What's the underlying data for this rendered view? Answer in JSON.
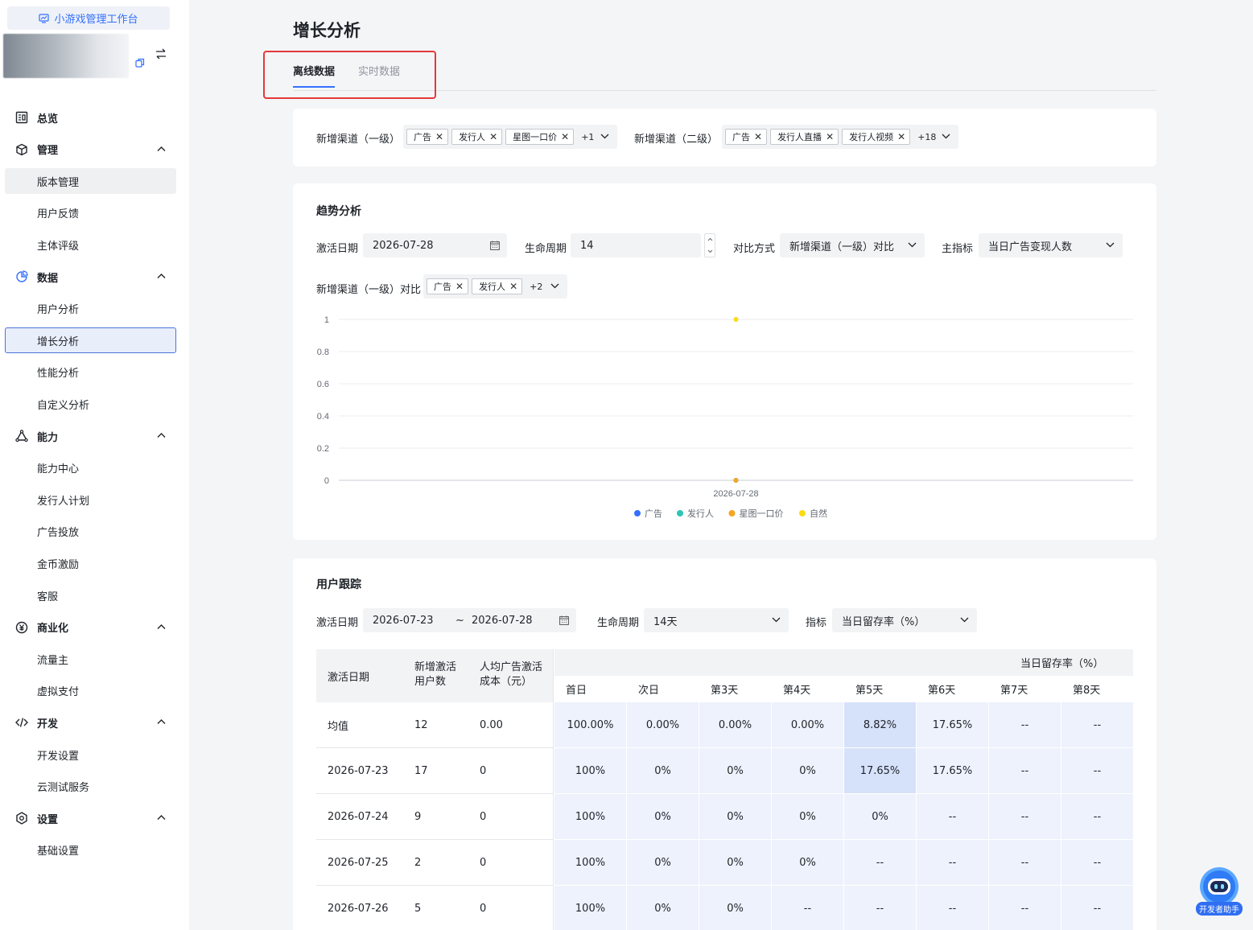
{
  "sidebar": {
    "workspace_label": "小游戏管理工作台",
    "groups": [
      {
        "label": "总览"
      },
      {
        "label": "管理",
        "items": [
          "版本管理",
          "用户反馈",
          "主体评级"
        ]
      },
      {
        "label": "数据",
        "items": [
          "用户分析",
          "增长分析",
          "性能分析",
          "自定义分析"
        ]
      },
      {
        "label": "能力",
        "items": [
          "能力中心",
          "发行人计划",
          "广告投放",
          "金币激励",
          "客服"
        ]
      },
      {
        "label": "商业化",
        "items": [
          "流量主",
          "虚拟支付"
        ]
      },
      {
        "label": "开发",
        "items": [
          "开发设置",
          "云测试服务"
        ]
      },
      {
        "label": "设置",
        "items": [
          "基础设置"
        ]
      }
    ]
  },
  "page": {
    "title": "增长分析",
    "tabs": [
      "离线数据",
      "实时数据"
    ]
  },
  "filters": {
    "ch1_label": "新增渠道（一级）",
    "ch1_tags": [
      "广告",
      "发行人",
      "星图一口价"
    ],
    "ch1_more": "+1",
    "ch2_label": "新增渠道（二级）",
    "ch2_tags": [
      "广告",
      "发行人直播",
      "发行人视频"
    ],
    "ch2_more": "+18"
  },
  "trend": {
    "title": "趋势分析",
    "date_label": "激活日期",
    "date_value": "2026-07-28",
    "life_label": "生命周期",
    "life_value": "14",
    "compare_label": "对比方式",
    "compare_value": "新增渠道（一级）对比",
    "metric_label": "主指标",
    "metric_value": "当日广告变现人数",
    "ch_label": "新增渠道（一级）对比",
    "ch_tags": [
      "广告",
      "发行人"
    ],
    "ch_more": "+2"
  },
  "chart_data": {
    "type": "line",
    "categories": [
      "2026-07-28"
    ],
    "y_ticks": [
      "1",
      "0.8",
      "0.6",
      "0.4",
      "0.2",
      "0"
    ],
    "ylim": [
      0,
      1
    ],
    "series": [
      {
        "name": "广告",
        "color": "#3370ff",
        "values": [
          0
        ]
      },
      {
        "name": "发行人",
        "color": "#2ec5b6",
        "values": [
          0
        ]
      },
      {
        "name": "星图一口价",
        "color": "#f5a623",
        "values": [
          0
        ]
      },
      {
        "name": "自然",
        "color": "#fadb14",
        "values": [
          1
        ]
      }
    ],
    "legend": "bottom",
    "grid": true
  },
  "tracking": {
    "title": "用户跟踪",
    "date_label": "激活日期",
    "date_start": "2026-07-23",
    "date_sep": "~",
    "date_end": "2026-07-28",
    "life_label": "生命周期",
    "life_value": "14天",
    "metric_label": "指标",
    "metric_value": "当日留存率（%）",
    "table": {
      "col_date": "激活日期",
      "col_users": "新增激活用户数",
      "col_cost": "人均广告激活成本（元）",
      "group_header": "当日留存率（%）",
      "day_headers": [
        "首日",
        "次日",
        "第3天",
        "第4天",
        "第5天",
        "第6天",
        "第7天",
        "第8天"
      ],
      "rows": [
        {
          "date": "均值",
          "users": "12",
          "cost": "0.00",
          "vals": [
            "100.00%",
            "0.00%",
            "0.00%",
            "0.00%",
            "8.82%",
            "17.65%",
            "--",
            "--"
          ]
        },
        {
          "date": "2026-07-23",
          "users": "17",
          "cost": "0",
          "vals": [
            "100%",
            "0%",
            "0%",
            "0%",
            "17.65%",
            "17.65%",
            "--",
            "--"
          ]
        },
        {
          "date": "2026-07-24",
          "users": "9",
          "cost": "0",
          "vals": [
            "100%",
            "0%",
            "0%",
            "0%",
            "0%",
            "--",
            "--",
            "--"
          ]
        },
        {
          "date": "2026-07-25",
          "users": "2",
          "cost": "0",
          "vals": [
            "100%",
            "0%",
            "0%",
            "0%",
            "--",
            "--",
            "--",
            "--"
          ]
        },
        {
          "date": "2026-07-26",
          "users": "5",
          "cost": "0",
          "vals": [
            "100%",
            "0%",
            "0%",
            "--",
            "--",
            "--",
            "--",
            "--"
          ]
        }
      ]
    }
  },
  "assistant": {
    "label": "开发者助手"
  }
}
